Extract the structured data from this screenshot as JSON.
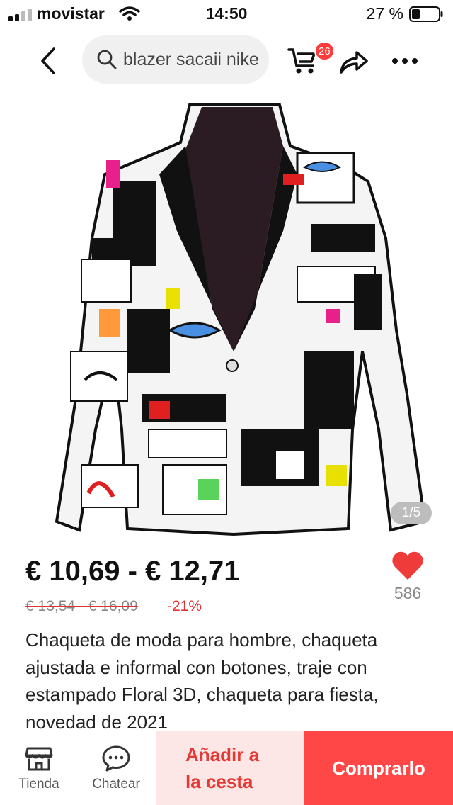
{
  "status_bar": {
    "carrier": "movistar",
    "time": "14:50",
    "battery": "27 %"
  },
  "header": {
    "search_query": "blazer sacaii nike",
    "cart_count": "26"
  },
  "gallery": {
    "counter": "1/5"
  },
  "product": {
    "price": "€ 10,69 - € 12,71",
    "old_price": "€ 13,54 - € 16,09",
    "discount": "-21%",
    "favorites": "586",
    "title": "Chaqueta de moda para hombre, chaqueta ajustada e informal con botones, traje con estampado Floral 3D, chaqueta para fiesta, novedad de 2021"
  },
  "bottom_bar": {
    "store_label": "Tienda",
    "chat_label": "Chatear",
    "add_to_cart_line1": "Añadir a",
    "add_to_cart_line2": "la cesta",
    "buy_label": "Comprarlo"
  },
  "colors": {
    "accent": "#ff4747",
    "accent_light": "#fde6e6",
    "price_red": "#e13232"
  },
  "icons": [
    "signal-icon",
    "wifi-icon",
    "battery-icon",
    "back-icon",
    "search-icon",
    "cart-icon",
    "share-icon",
    "more-icon",
    "heart-icon",
    "store-icon",
    "chat-icon"
  ]
}
